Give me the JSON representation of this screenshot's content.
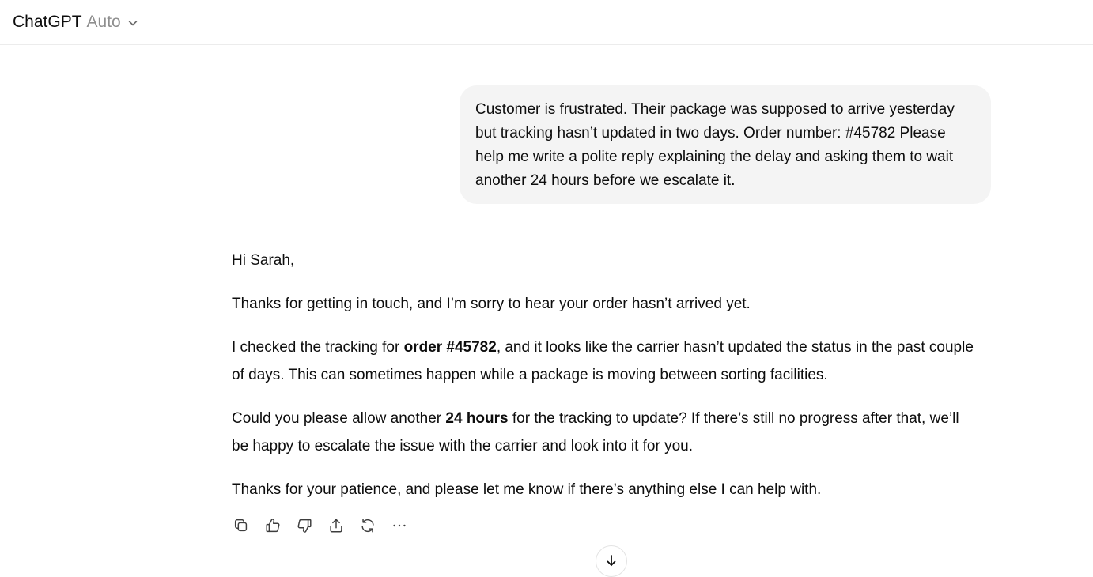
{
  "header": {
    "model_name": "ChatGPT",
    "model_mode": "Auto"
  },
  "user_message": {
    "text": "Customer is frustrated. Their package was supposed to arrive yesterday but tracking hasn’t updated in two days. Order number: #45782 Please help me write a polite reply explaining the delay and asking them to wait another 24 hours before we escalate it."
  },
  "assistant_message": {
    "greeting": "Hi Sarah,",
    "p1": "Thanks for getting in touch, and I’m sorry to hear your order hasn’t arrived yet.",
    "p2_before": "I checked the tracking for ",
    "p2_bold": "order #45782",
    "p2_after": ", and it looks like the carrier hasn’t updated the status in the past couple of days. This can sometimes happen while a package is moving between sorting facilities.",
    "p3_before": "Could you please allow another ",
    "p3_bold": "24 hours",
    "p3_after": " for the tracking to update? If there’s still no progress after that, we’ll be happy to escalate the issue with the carrier and look into it for you.",
    "p4": "Thanks for your patience, and please let me know if there’s anything else I can help with."
  },
  "actions": {
    "icons": [
      "copy-icon",
      "thumbs-up-icon",
      "thumbs-down-icon",
      "share-icon",
      "regenerate-icon",
      "more-icon"
    ]
  },
  "scroll": {
    "icon": "arrow-down-icon"
  }
}
